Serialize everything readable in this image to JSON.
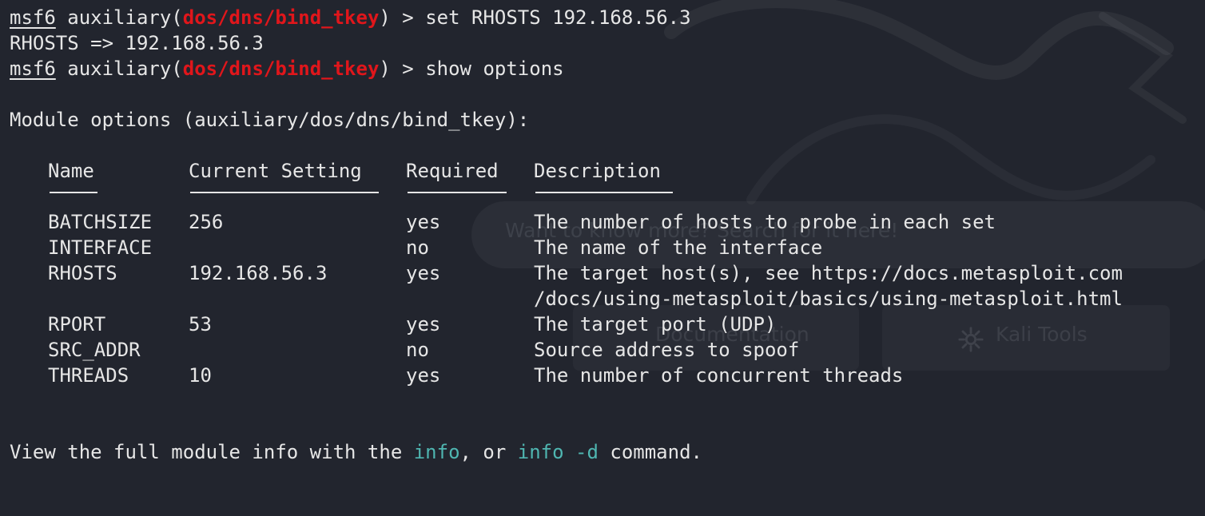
{
  "colors": {
    "background": "#22252e",
    "text": "#e6e6e6",
    "module_red": "#e0161b",
    "command_cyan": "#4fb6b1"
  },
  "prompt": {
    "msf": "msf6",
    "module_type": "auxiliary",
    "module_path": "dos/dns/bind_tkey",
    "arrow": "> "
  },
  "commands": {
    "set_rhosts": "set RHOSTS 192.168.56.3",
    "set_result": "RHOSTS => 192.168.56.3",
    "show_options": "show options"
  },
  "options": {
    "heading": "Module options (auxiliary/dos/dns/bind_tkey):",
    "headers": {
      "name": "Name",
      "setting": "Current Setting",
      "required": "Required",
      "description": "Description"
    },
    "rows": [
      {
        "name": "BATCHSIZE",
        "setting": "256",
        "required": "yes",
        "description": "The number of hosts to probe in each set"
      },
      {
        "name": "INTERFACE",
        "setting": "",
        "required": "no",
        "description": "The name of the interface"
      },
      {
        "name": "RHOSTS",
        "setting": "192.168.56.3",
        "required": "yes",
        "description": "The target host(s), see https://docs.metasploit.com",
        "description_cont": "/docs/using-metasploit/basics/using-metasploit.html"
      },
      {
        "name": "RPORT",
        "setting": "53",
        "required": "yes",
        "description": "The target port (UDP)"
      },
      {
        "name": "SRC_ADDR",
        "setting": "",
        "required": "no",
        "description": "Source address to spoof"
      },
      {
        "name": "THREADS",
        "setting": "10",
        "required": "yes",
        "description": "The number of concurrent threads"
      }
    ]
  },
  "footer": {
    "prefix": "View the full module info with the ",
    "cmd1": "info",
    "middle": ", or ",
    "cmd2": "info -d",
    "suffix": " command."
  },
  "background": {
    "search_text": "Want to know more? Search for it here!",
    "card_left_label": "Documentation",
    "card_right_label": "Kali Tools",
    "card_right_icon": "gear-icon",
    "watermark_icon": "kali-dragon-icon"
  }
}
